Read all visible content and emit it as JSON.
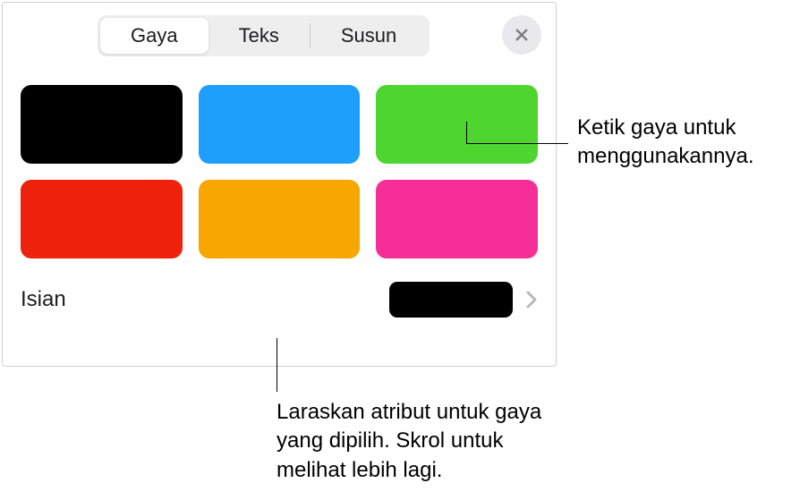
{
  "tabs": {
    "style": "Gaya",
    "text": "Teks",
    "arrange": "Susun"
  },
  "swatches": [
    {
      "color": "#000000"
    },
    {
      "color": "#1E9FFB"
    },
    {
      "color": "#4FD52F"
    },
    {
      "color": "#EE220C"
    },
    {
      "color": "#F8A601"
    },
    {
      "color": "#F62E97"
    }
  ],
  "fill": {
    "label": "Isian",
    "color": "#000000"
  },
  "callouts": {
    "style": "Ketik gaya untuk menggunakannya.",
    "attributes": "Laraskan atribut untuk gaya yang dipilih. Skrol untuk melihat lebih lagi."
  }
}
